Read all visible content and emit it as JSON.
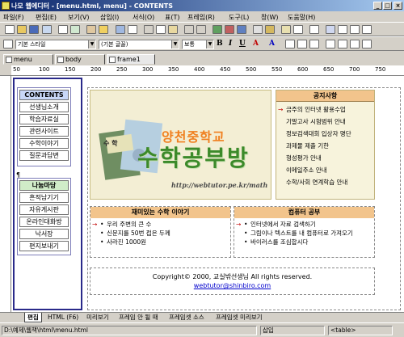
{
  "window": {
    "title": "나모 웹에디터 - [menu.html, menu] - CONTENTS",
    "controls": [
      "_",
      "□",
      "×"
    ]
  },
  "menu": [
    "파일(F)",
    "편집(E)",
    "보기(V)",
    "삽입(I)",
    "서식(O)",
    "표(T)",
    "프레임(R)",
    "도구(L)",
    "창(W)",
    "도움말(H)"
  ],
  "format_toolbar": {
    "style": "기본 스타일",
    "font": "(기본 글꼴)",
    "size": "보통",
    "bold": "B",
    "italic": "I",
    "underline": "U",
    "color_a": "A",
    "color_b": "A"
  },
  "doc_tabs": [
    "menu",
    "body",
    "frame1"
  ],
  "ruler_marks": [
    "50",
    "100",
    "150",
    "200",
    "250",
    "300",
    "350",
    "400",
    "450",
    "500",
    "550",
    "600",
    "650",
    "700",
    "750"
  ],
  "left_nav": {
    "contents_title": "CONTENTS",
    "contents_items": [
      "선생님소개",
      "학습자료실",
      "관련사이트",
      "수학이야기",
      "질문과답변"
    ],
    "share_title": "나눔마당",
    "share_items": [
      "흔적남기기",
      "자유게시판",
      "온라인대화방",
      "낙서장",
      "편지보내기"
    ],
    "marker": "¶"
  },
  "banner": {
    "school": "양천중학교",
    "title": "수학공부방",
    "url": "http://webtutor.pe.kr/math",
    "book_label": "수 학"
  },
  "notice": {
    "title": "공지사항",
    "items": [
      "금주의 인터넷 활용수업",
      "기말고사 시험범위 안내",
      "정보검색대회 입상자 명단",
      "과제물 제출 기한",
      "형성평가 안내",
      "이메일주소 안내",
      "수학/사회 연계학습 안내"
    ]
  },
  "stories": {
    "title": "재미있는 수학 이야기",
    "items": [
      "우리 주변의 큰 수",
      "신문지를 50번 접은 두께",
      "사라진 1000원"
    ]
  },
  "computer": {
    "title": "컴퓨터 공부",
    "items": [
      "인터넷에서 자료 검색하기",
      "그림이나 텍스트를 내 컴퓨터로 가져오기",
      "바이러스를 조심합시다"
    ]
  },
  "footer": {
    "copyright": "Copyright© 2000, 교실밖선생님 All rights reserved.",
    "email": "webtutor@shinbiro.com"
  },
  "bottom_tabs": [
    "편집",
    "HTML (F6)",
    "미리보기",
    "프레임 안 될 때",
    "프레임셋 소스",
    "프레임셋 미리보기"
  ],
  "status": {
    "path": "D:\\예제\\웹책\\html\\menu.html",
    "mode": "삽입",
    "tag": "<table>"
  }
}
